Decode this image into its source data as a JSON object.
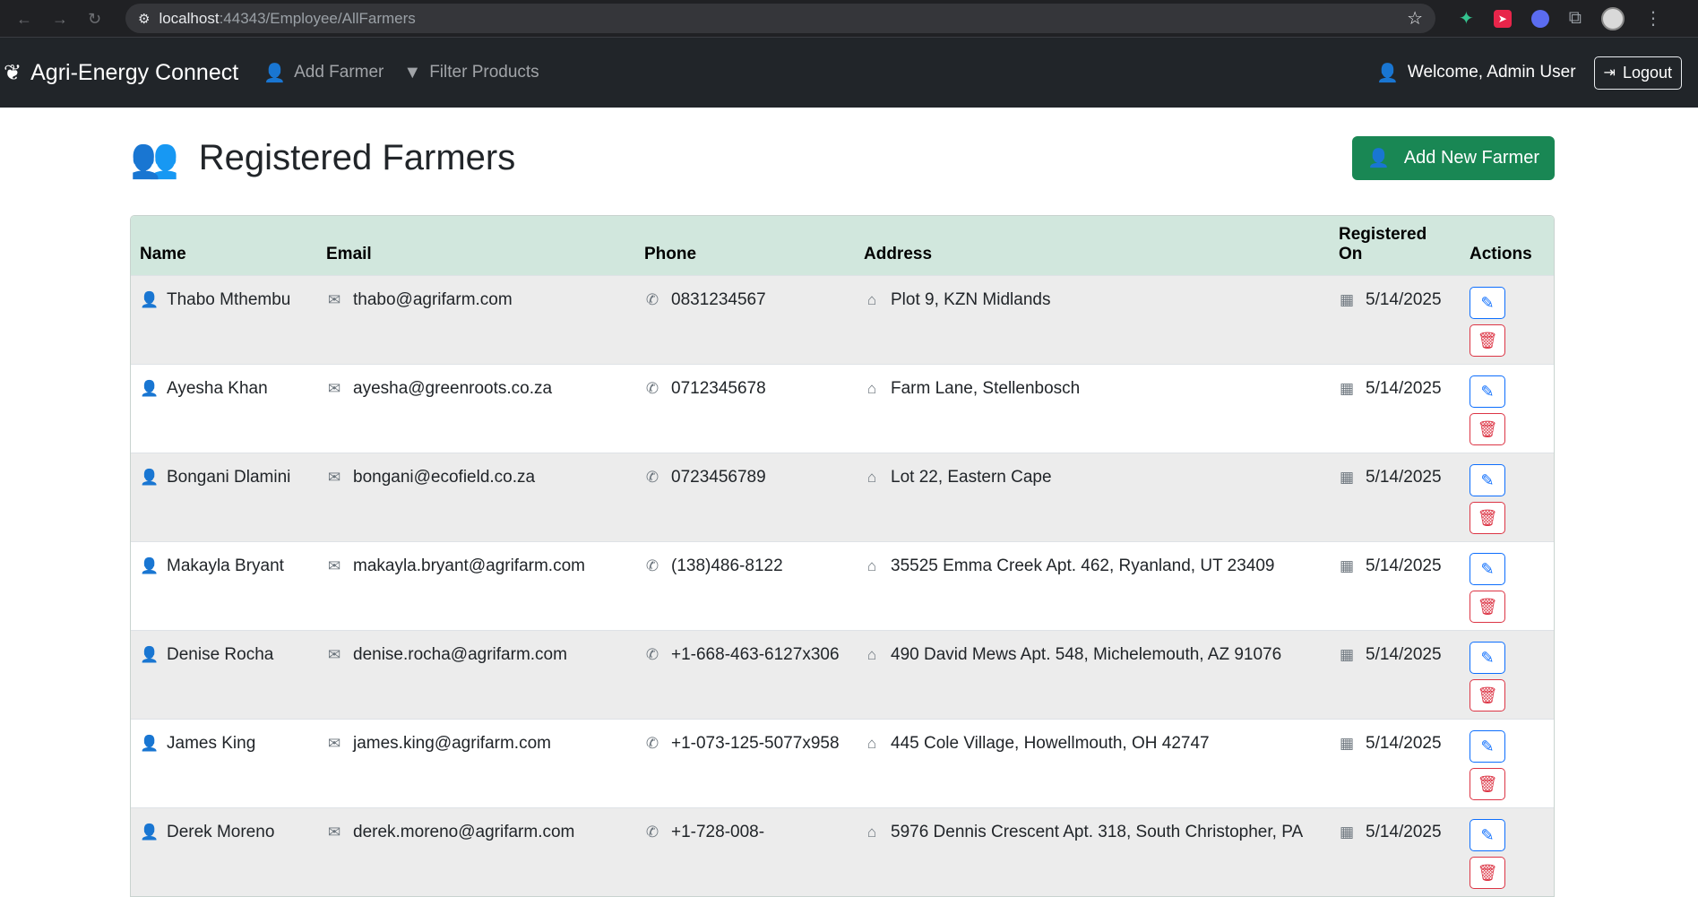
{
  "browser": {
    "url_host": "localhost",
    "url_path": ":44343/Employee/AllFarmers"
  },
  "navbar": {
    "brand": "Agri-Energy Connect",
    "links": [
      {
        "label": "Add Farmer",
        "icon": "user-plus-icon"
      },
      {
        "label": "Filter Products",
        "icon": "filter-icon"
      }
    ],
    "welcome": "Welcome, Admin User",
    "logout": "Logout"
  },
  "page": {
    "title": "Registered Farmers",
    "add_button": "Add New Farmer"
  },
  "table": {
    "headers": {
      "name": "Name",
      "email": "Email",
      "phone": "Phone",
      "address": "Address",
      "registered_line1": "Registered",
      "registered_line2": "On",
      "actions": "Actions"
    },
    "rows": [
      {
        "name": "Thabo Mthembu",
        "email": "thabo@agrifarm.com",
        "phone": "0831234567",
        "address": "Plot 9, KZN Midlands",
        "registered": "5/14/2025"
      },
      {
        "name": "Ayesha Khan",
        "email": "ayesha@greenroots.co.za",
        "phone": "0712345678",
        "address": "Farm Lane, Stellenbosch",
        "registered": "5/14/2025"
      },
      {
        "name": "Bongani Dlamini",
        "email": "bongani@ecofield.co.za",
        "phone": "0723456789",
        "address": "Lot 22, Eastern Cape",
        "registered": "5/14/2025"
      },
      {
        "name": "Makayla Bryant",
        "email": "makayla.bryant@agrifarm.com",
        "phone": "(138)486-8122",
        "address": "35525 Emma Creek Apt. 462, Ryanland, UT 23409",
        "registered": "5/14/2025"
      },
      {
        "name": "Denise Rocha",
        "email": "denise.rocha@agrifarm.com",
        "phone": "+1-668-463-6127x306",
        "address": "490 David Mews Apt. 548, Michelemouth, AZ 91076",
        "registered": "5/14/2025"
      },
      {
        "name": "James King",
        "email": "james.king@agrifarm.com",
        "phone": "+1-073-125-5077x958",
        "address": "445 Cole Village, Howellmouth, OH 42747",
        "registered": "5/14/2025"
      },
      {
        "name": "Derek Moreno",
        "email": "derek.moreno@agrifarm.com",
        "phone": "+1-728-008-",
        "address": "5976 Dennis Crescent Apt. 318, South Christopher, PA",
        "registered": "5/14/2025"
      }
    ]
  },
  "colors": {
    "navbar_bg": "#212529",
    "accent_green": "#198754",
    "table_header_bg": "#d1e7dd",
    "edit_blue": "#0d6efd",
    "delete_red": "#dc3545"
  }
}
